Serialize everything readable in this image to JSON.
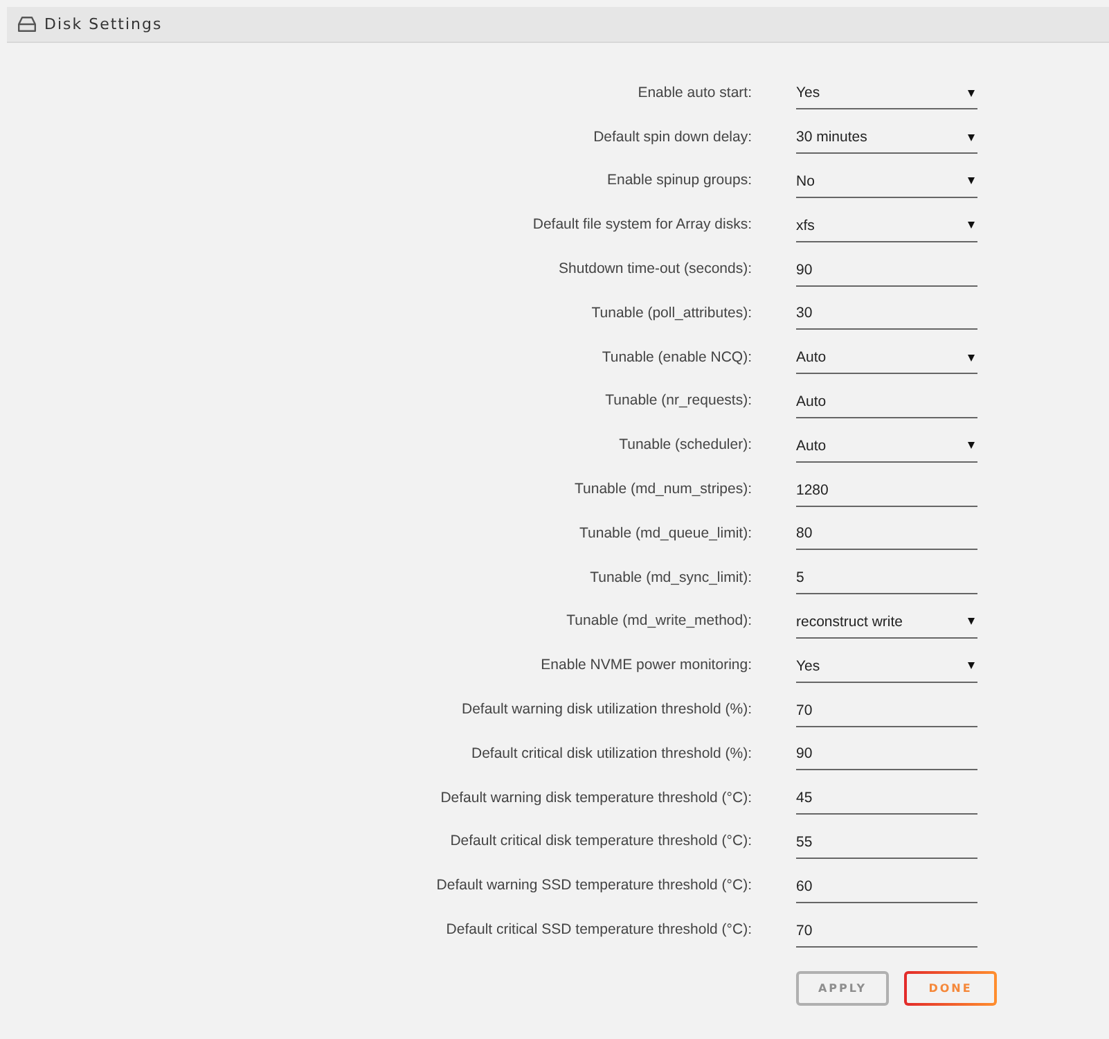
{
  "header": {
    "title": "Disk Settings"
  },
  "settings": [
    {
      "label": "Enable auto start:",
      "kind": "select",
      "value": "Yes"
    },
    {
      "label": "Default spin down delay:",
      "kind": "select",
      "value": "30 minutes"
    },
    {
      "label": "Enable spinup groups:",
      "kind": "select",
      "value": "No"
    },
    {
      "label": "Default file system for Array disks:",
      "kind": "select",
      "value": "xfs"
    },
    {
      "label": "Shutdown time-out (seconds):",
      "kind": "input",
      "value": "90"
    },
    {
      "label": "Tunable (poll_attributes):",
      "kind": "input",
      "value": "30"
    },
    {
      "label": "Tunable (enable NCQ):",
      "kind": "select",
      "value": "Auto"
    },
    {
      "label": "Tunable (nr_requests):",
      "kind": "input",
      "value": "Auto"
    },
    {
      "label": "Tunable (scheduler):",
      "kind": "select",
      "value": "Auto"
    },
    {
      "label": "Tunable (md_num_stripes):",
      "kind": "input",
      "value": "1280"
    },
    {
      "label": "Tunable (md_queue_limit):",
      "kind": "input",
      "value": "80"
    },
    {
      "label": "Tunable (md_sync_limit):",
      "kind": "input",
      "value": "5"
    },
    {
      "label": "Tunable (md_write_method):",
      "kind": "select",
      "value": "reconstruct write"
    },
    {
      "label": "Enable NVME power monitoring:",
      "kind": "select",
      "value": "Yes"
    },
    {
      "label": "Default warning disk utilization threshold (%):",
      "kind": "input",
      "value": "70"
    },
    {
      "label": "Default critical disk utilization threshold (%):",
      "kind": "input",
      "value": "90"
    },
    {
      "label": "Default warning disk temperature threshold (°C):",
      "kind": "input",
      "value": "45"
    },
    {
      "label": "Default critical disk temperature threshold (°C):",
      "kind": "input",
      "value": "55"
    },
    {
      "label": "Default warning SSD temperature threshold (°C):",
      "kind": "input",
      "value": "60"
    },
    {
      "label": "Default critical SSD temperature threshold (°C):",
      "kind": "input",
      "value": "70"
    }
  ],
  "buttons": [
    {
      "label": "APPLY",
      "disabled": true
    },
    {
      "label": "DONE",
      "disabled": false
    }
  ]
}
